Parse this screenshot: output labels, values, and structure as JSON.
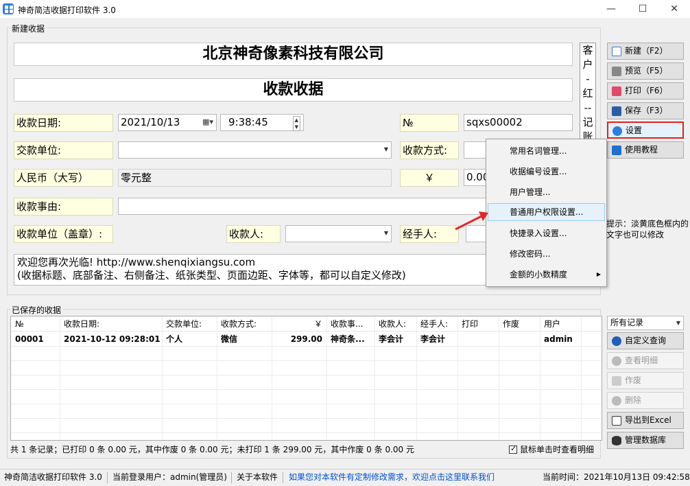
{
  "window": {
    "title": "神奇简洁收据打印软件 3.0",
    "minimize": "—",
    "maximize": "☐",
    "close": "✕"
  },
  "new_receipt": {
    "group_label": "新建收据",
    "company_name": "北京神奇像素科技有限公司",
    "receipt_title": "收款收据",
    "side_copy": [
      "客",
      "户",
      "-",
      "红",
      "--",
      "记",
      "账"
    ],
    "date_label": "收款日期:",
    "date_value": "2021/10/13",
    "time_value": "9:38:45",
    "no_label": "№",
    "no_value": "sqxs00002",
    "payer_label": "交款单位:",
    "payer_value": "",
    "method_label": "收款方式:",
    "rmb_label": "人民币（大写）",
    "rmb_value": "零元整",
    "yen_label": "￥",
    "amount_value": "0.00",
    "reason_label": "收款事由:",
    "unit_label": "收款单位（盖章）:",
    "receiver_label": "收款人:",
    "handler_label": "经手人:",
    "message_line1": "欢迎您再次光临! http://www.shenqixiangsu.com",
    "message_line2": "(收据标题、底部备注、右侧备注、纸张类型、页面边距、字体等，都可以自定义修改)"
  },
  "toolbar": {
    "new": "新建（F2）",
    "preview": "预览（F5）",
    "print": "打印（F6）",
    "save": "保存（F3）",
    "settings": "设置",
    "tutorial": "使用教程"
  },
  "menu": {
    "items": [
      "常用名词管理...",
      "收据编号设置...",
      "用户管理...",
      "普通用户权限设置...",
      "快捷录入设置...",
      "修改密码...",
      "金额的小数精度"
    ]
  },
  "hint": "提示：淡黄底色框内的文字也可以修改",
  "saved": {
    "group_label": "已保存的收据",
    "columns": [
      "№",
      "收款日期:",
      "交款单位:",
      "收款方式:",
      "￥",
      "收款事...",
      "收款人:",
      "经手人:",
      "打印",
      "作废",
      "用户"
    ],
    "rows": [
      [
        "00001",
        "2021-10-12 09:28:01",
        "个人",
        "微信",
        "299.00",
        "神奇条...",
        "李会计",
        "李会计",
        "",
        "",
        "admin"
      ]
    ],
    "summary": "共 1 条记录；已打印 0 条 0.00 元，其中作废 0 条 0.00 元；未打印 1 条 299.00 元，其中作废 0 条 0.00 元",
    "click_view_label": "鼠标单击时查看明细",
    "filter_value": "所有记录"
  },
  "side_actions": {
    "custom_query": "自定义查询",
    "view_detail": "查看明细",
    "void": "作废",
    "delete": "删除",
    "export_excel": "导出到Excel",
    "manage_db": "管理数据库"
  },
  "statusbar": {
    "app": "神奇简洁收据打印软件 3.0",
    "user": "当前登录用户：admin(管理员)",
    "about": "关于本软件",
    "link": "如果您对本软件有定制修改需求，欢迎点击这里联系我们",
    "time": "当前时间：2021年10月13日 09:42:58"
  },
  "colors": {
    "label_bg": "#ffffe1",
    "focus_border": "#e02020",
    "link": "#0050d0",
    "arrow": "#e02828"
  }
}
